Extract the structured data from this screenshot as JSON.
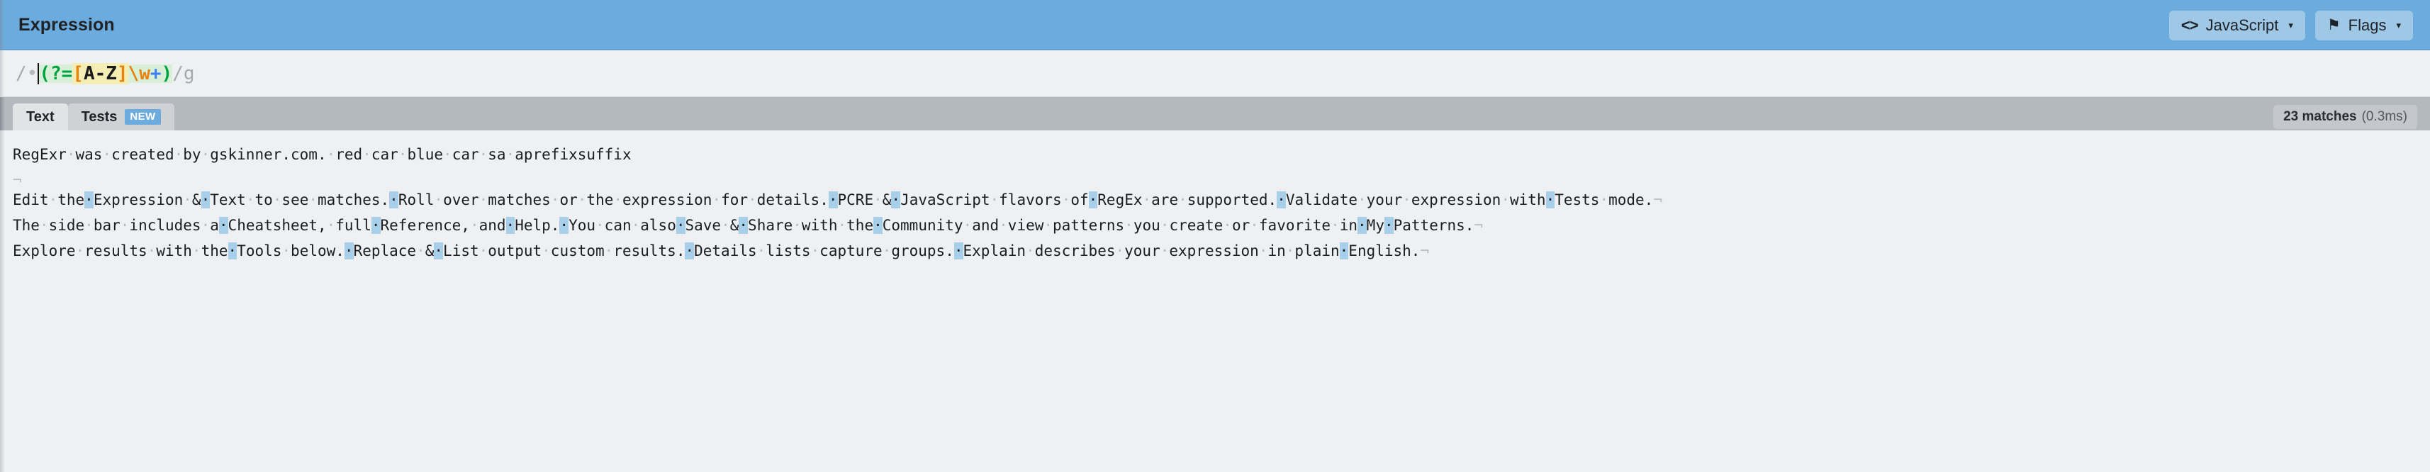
{
  "header": {
    "title": "Expression",
    "buttons": [
      {
        "name": "flavor",
        "icon": "code-icon",
        "icon_glyph": "<>",
        "label": "JavaScript",
        "caret": "▾"
      },
      {
        "name": "flags",
        "icon": "flag-icon",
        "icon_glyph": "⚑",
        "label": "Flags",
        "caret": "▾"
      }
    ]
  },
  "expression": {
    "open_delimiter": "/",
    "leading_space_marker": "•",
    "pattern_plain": "(?=[A-Z]\\w+)",
    "tokens": {
      "group_open": "(",
      "lookahead": "?=",
      "class_open": "[",
      "class_body": "A-Z",
      "class_close": "]",
      "escape_w": "\\w",
      "quantifier": "+",
      "group_close": ")"
    },
    "close_delimiter": "/",
    "flags": "g",
    "colors": {
      "group_bg": "#d8efd8",
      "class_bg": "#f4eeb4",
      "green": "#00a33f",
      "orange": "#e8820c",
      "blue": "#3d7ef2",
      "delimiter": "#a7a9ad"
    }
  },
  "tabs": {
    "items": [
      {
        "label": "Text",
        "active": true,
        "badge": null
      },
      {
        "label": "Tests",
        "active": false,
        "badge": "NEW"
      }
    ]
  },
  "status": {
    "match_count_label": "23 matches",
    "time_label": "(0.3ms)"
  },
  "text_document": {
    "space_marker": "·",
    "return_marker": "¬",
    "paragraphs": [
      {
        "id": "p1",
        "plain": "RegExr was created by gskinner.com. red car blue car sa aprefixsuffix",
        "segments": [
          {
            "t": "RegExr",
            "k": "txt"
          },
          {
            "t": "·",
            "k": "sp"
          },
          {
            "t": "was",
            "k": "txt"
          },
          {
            "t": "·",
            "k": "sp"
          },
          {
            "t": "created",
            "k": "txt"
          },
          {
            "t": "·",
            "k": "sp"
          },
          {
            "t": "by",
            "k": "txt"
          },
          {
            "t": "·",
            "k": "sp"
          },
          {
            "t": "gskinner.com.",
            "k": "txt"
          },
          {
            "t": "·",
            "k": "sp"
          },
          {
            "t": "red",
            "k": "txt"
          },
          {
            "t": "·",
            "k": "sp"
          },
          {
            "t": "car",
            "k": "txt"
          },
          {
            "t": "·",
            "k": "sp"
          },
          {
            "t": "blue",
            "k": "txt"
          },
          {
            "t": "·",
            "k": "sp"
          },
          {
            "t": "car",
            "k": "txt"
          },
          {
            "t": "·",
            "k": "sp"
          },
          {
            "t": "sa",
            "k": "txt"
          },
          {
            "t": "·",
            "k": "sp"
          },
          {
            "t": "aprefixsuffix",
            "k": "txt"
          }
        ]
      },
      {
        "id": "p2",
        "plain": "Edit the Expression & Text to see matches. Roll over matches or the expression for details. PCRE & JavaScript flavors of RegEx are supported. Validate your expression with Tests mode.",
        "segments": [
          {
            "t": "¬",
            "k": "ret"
          },
          {
            "t": "\n",
            "k": "br"
          },
          {
            "t": "Edit",
            "k": "txt"
          },
          {
            "t": "·",
            "k": "sp"
          },
          {
            "t": "the",
            "k": "txt"
          },
          {
            "t": "·",
            "k": "hit"
          },
          {
            "t": "Expression",
            "k": "txt"
          },
          {
            "t": "·",
            "k": "sp"
          },
          {
            "t": "&",
            "k": "txt"
          },
          {
            "t": "·",
            "k": "hit"
          },
          {
            "t": "Text",
            "k": "txt"
          },
          {
            "t": "·",
            "k": "sp"
          },
          {
            "t": "to",
            "k": "txt"
          },
          {
            "t": "·",
            "k": "sp"
          },
          {
            "t": "see",
            "k": "txt"
          },
          {
            "t": "·",
            "k": "sp"
          },
          {
            "t": "matches.",
            "k": "txt"
          },
          {
            "t": "·",
            "k": "hit"
          },
          {
            "t": "Roll",
            "k": "txt"
          },
          {
            "t": "·",
            "k": "sp"
          },
          {
            "t": "over",
            "k": "txt"
          },
          {
            "t": "·",
            "k": "sp"
          },
          {
            "t": "matches",
            "k": "txt"
          },
          {
            "t": "·",
            "k": "sp"
          },
          {
            "t": "or",
            "k": "txt"
          },
          {
            "t": "·",
            "k": "sp"
          },
          {
            "t": "the",
            "k": "txt"
          },
          {
            "t": "·",
            "k": "sp"
          },
          {
            "t": "expression",
            "k": "txt"
          },
          {
            "t": "·",
            "k": "sp"
          },
          {
            "t": "for",
            "k": "txt"
          },
          {
            "t": "·",
            "k": "sp"
          },
          {
            "t": "details.",
            "k": "txt"
          },
          {
            "t": "·",
            "k": "hit"
          },
          {
            "t": "PCRE",
            "k": "txt"
          },
          {
            "t": "·",
            "k": "sp"
          },
          {
            "t": "&",
            "k": "txt"
          },
          {
            "t": "·",
            "k": "hit"
          },
          {
            "t": "JavaScript",
            "k": "txt"
          },
          {
            "t": "·",
            "k": "sp"
          },
          {
            "t": "flavors",
            "k": "txt"
          },
          {
            "t": "·",
            "k": "sp"
          },
          {
            "t": "of",
            "k": "txt"
          },
          {
            "t": "·",
            "k": "hit"
          },
          {
            "t": "RegEx",
            "k": "txt"
          },
          {
            "t": "·",
            "k": "sp"
          },
          {
            "t": "are",
            "k": "txt"
          },
          {
            "t": "·",
            "k": "sp"
          },
          {
            "t": "supported.",
            "k": "txt"
          },
          {
            "t": "·",
            "k": "hit"
          },
          {
            "t": "Validate",
            "k": "txt"
          },
          {
            "t": "·",
            "k": "sp"
          },
          {
            "t": "your",
            "k": "txt"
          },
          {
            "t": "·",
            "k": "sp"
          },
          {
            "t": "expression",
            "k": "txt"
          },
          {
            "t": "·",
            "k": "sp"
          },
          {
            "t": "with",
            "k": "txt"
          },
          {
            "t": "·",
            "k": "hit"
          },
          {
            "t": "Tests",
            "k": "txt"
          },
          {
            "t": "·",
            "k": "sp"
          },
          {
            "t": "mode.",
            "k": "txt"
          },
          {
            "t": "¬",
            "k": "ret"
          }
        ]
      },
      {
        "id": "p3",
        "plain": "The side bar includes a Cheatsheet, full Reference, and Help. You can also Save & Share with the Community and view patterns you create or favorite in My Patterns.",
        "segments": [
          {
            "t": "The",
            "k": "txt"
          },
          {
            "t": "·",
            "k": "sp"
          },
          {
            "t": "side",
            "k": "txt"
          },
          {
            "t": "·",
            "k": "sp"
          },
          {
            "t": "bar",
            "k": "txt"
          },
          {
            "t": "·",
            "k": "sp"
          },
          {
            "t": "includes",
            "k": "txt"
          },
          {
            "t": "·",
            "k": "sp"
          },
          {
            "t": "a",
            "k": "txt"
          },
          {
            "t": "·",
            "k": "hit"
          },
          {
            "t": "Cheatsheet,",
            "k": "txt"
          },
          {
            "t": "·",
            "k": "sp"
          },
          {
            "t": "full",
            "k": "txt"
          },
          {
            "t": "·",
            "k": "hit"
          },
          {
            "t": "Reference,",
            "k": "txt"
          },
          {
            "t": "·",
            "k": "sp"
          },
          {
            "t": "and",
            "k": "txt"
          },
          {
            "t": "·",
            "k": "hit"
          },
          {
            "t": "Help.",
            "k": "txt"
          },
          {
            "t": "·",
            "k": "hit"
          },
          {
            "t": "You",
            "k": "txt"
          },
          {
            "t": "·",
            "k": "sp"
          },
          {
            "t": "can",
            "k": "txt"
          },
          {
            "t": "·",
            "k": "sp"
          },
          {
            "t": "also",
            "k": "txt"
          },
          {
            "t": "·",
            "k": "hit"
          },
          {
            "t": "Save",
            "k": "txt"
          },
          {
            "t": "·",
            "k": "sp"
          },
          {
            "t": "&",
            "k": "txt"
          },
          {
            "t": "·",
            "k": "hit"
          },
          {
            "t": "Share",
            "k": "txt"
          },
          {
            "t": "·",
            "k": "sp"
          },
          {
            "t": "with",
            "k": "txt"
          },
          {
            "t": "·",
            "k": "sp"
          },
          {
            "t": "the",
            "k": "txt"
          },
          {
            "t": "·",
            "k": "hit"
          },
          {
            "t": "Community",
            "k": "txt"
          },
          {
            "t": "·",
            "k": "sp"
          },
          {
            "t": "and",
            "k": "txt"
          },
          {
            "t": "·",
            "k": "sp"
          },
          {
            "t": "view",
            "k": "txt"
          },
          {
            "t": "·",
            "k": "sp"
          },
          {
            "t": "patterns",
            "k": "txt"
          },
          {
            "t": "·",
            "k": "sp"
          },
          {
            "t": "you",
            "k": "txt"
          },
          {
            "t": "·",
            "k": "sp"
          },
          {
            "t": "create",
            "k": "txt"
          },
          {
            "t": "·",
            "k": "sp"
          },
          {
            "t": "or",
            "k": "txt"
          },
          {
            "t": "·",
            "k": "sp"
          },
          {
            "t": "favorite",
            "k": "txt"
          },
          {
            "t": "·",
            "k": "sp"
          },
          {
            "t": "in",
            "k": "txt"
          },
          {
            "t": "·",
            "k": "hit"
          },
          {
            "t": "My",
            "k": "txt"
          },
          {
            "t": "·",
            "k": "hit"
          },
          {
            "t": "Patterns.",
            "k": "txt"
          },
          {
            "t": "¬",
            "k": "ret"
          }
        ]
      },
      {
        "id": "p4",
        "plain": "Explore results with the Tools below. Replace & List output custom results. Details lists capture groups. Explain describes your expression in plain English.",
        "segments": [
          {
            "t": "Explore",
            "k": "txt"
          },
          {
            "t": "·",
            "k": "sp"
          },
          {
            "t": "results",
            "k": "txt"
          },
          {
            "t": "·",
            "k": "sp"
          },
          {
            "t": "with",
            "k": "txt"
          },
          {
            "t": "·",
            "k": "sp"
          },
          {
            "t": "the",
            "k": "txt"
          },
          {
            "t": "·",
            "k": "hit"
          },
          {
            "t": "Tools",
            "k": "txt"
          },
          {
            "t": "·",
            "k": "sp"
          },
          {
            "t": "below.",
            "k": "txt"
          },
          {
            "t": "·",
            "k": "hit"
          },
          {
            "t": "Replace",
            "k": "txt"
          },
          {
            "t": "·",
            "k": "sp"
          },
          {
            "t": "&",
            "k": "txt"
          },
          {
            "t": "·",
            "k": "hit"
          },
          {
            "t": "List",
            "k": "txt"
          },
          {
            "t": "·",
            "k": "sp"
          },
          {
            "t": "output",
            "k": "txt"
          },
          {
            "t": "·",
            "k": "sp"
          },
          {
            "t": "custom",
            "k": "txt"
          },
          {
            "t": "·",
            "k": "sp"
          },
          {
            "t": "results.",
            "k": "txt"
          },
          {
            "t": "·",
            "k": "hit"
          },
          {
            "t": "Details",
            "k": "txt"
          },
          {
            "t": "·",
            "k": "sp"
          },
          {
            "t": "lists",
            "k": "txt"
          },
          {
            "t": "·",
            "k": "sp"
          },
          {
            "t": "capture",
            "k": "txt"
          },
          {
            "t": "·",
            "k": "sp"
          },
          {
            "t": "groups.",
            "k": "txt"
          },
          {
            "t": "·",
            "k": "hit"
          },
          {
            "t": "Explain",
            "k": "txt"
          },
          {
            "t": "·",
            "k": "sp"
          },
          {
            "t": "describes",
            "k": "txt"
          },
          {
            "t": "·",
            "k": "sp"
          },
          {
            "t": "your",
            "k": "txt"
          },
          {
            "t": "·",
            "k": "sp"
          },
          {
            "t": "expression",
            "k": "txt"
          },
          {
            "t": "·",
            "k": "sp"
          },
          {
            "t": "in",
            "k": "txt"
          },
          {
            "t": "·",
            "k": "sp"
          },
          {
            "t": "plain",
            "k": "txt"
          },
          {
            "t": "·",
            "k": "hit"
          },
          {
            "t": "English.",
            "k": "txt"
          },
          {
            "t": "¬",
            "k": "ret"
          }
        ]
      }
    ]
  }
}
